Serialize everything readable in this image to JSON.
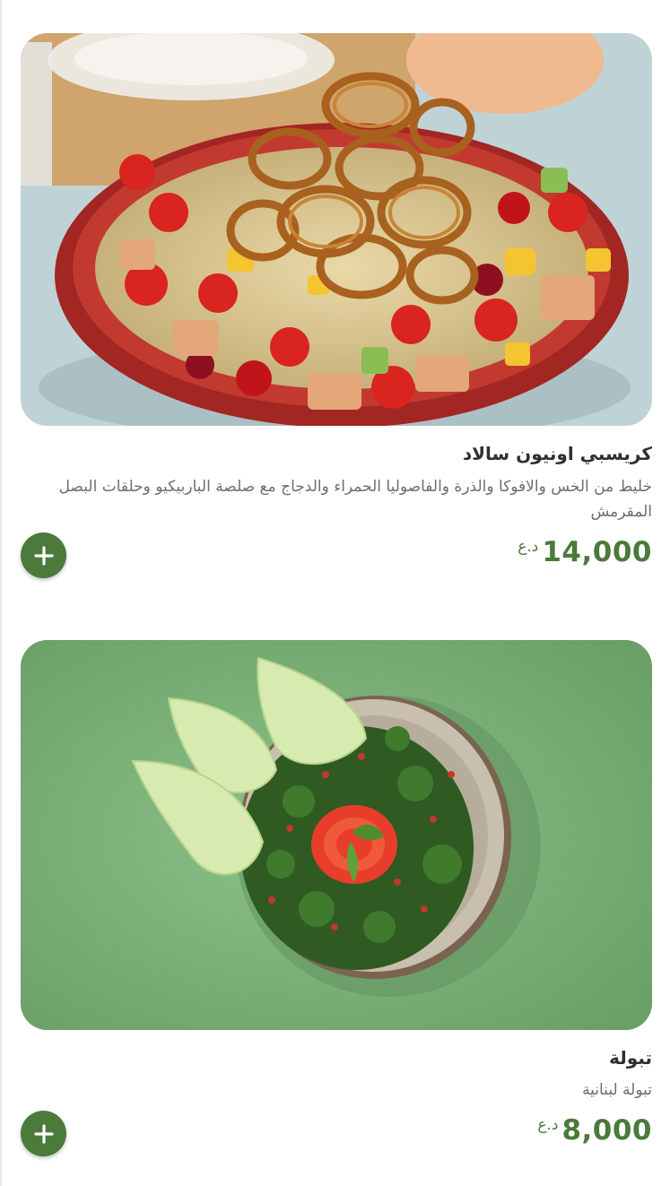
{
  "items": [
    {
      "title": "كريسبي اونيون سالاد",
      "description": "خليط من الخس والافوكا والذرة والفاصوليا الحمراء والدجاج مع صلصة الباربيكيو وحلقات البصل المقرمش",
      "price": "14,000",
      "currency": "د.ع",
      "image_alt": "crispy-onion-salad-photo"
    },
    {
      "title": "تبولة",
      "description": "تبولة لبنانية",
      "price": "8,000",
      "currency": "د.ع",
      "image_alt": "tabbouleh-photo"
    }
  ],
  "colors": {
    "accent": "#4b7a3b",
    "title": "#2f2f2f",
    "description": "#6e6e6e"
  },
  "icons": {
    "add": "plus-icon"
  }
}
